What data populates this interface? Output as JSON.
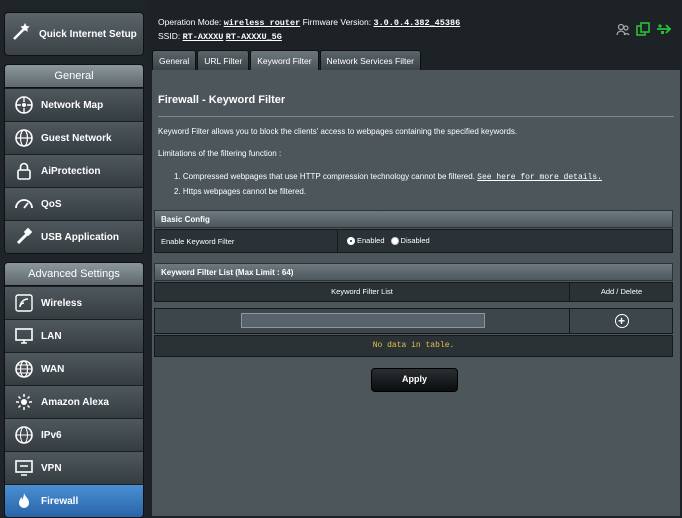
{
  "sidebar": {
    "quick_setup": "Quick Internet Setup",
    "general_header": "General",
    "general_items": [
      {
        "label": "Network Map",
        "icon": "network-map-icon"
      },
      {
        "label": "Guest Network",
        "icon": "guest-network-icon"
      },
      {
        "label": "AiProtection",
        "icon": "lock-icon"
      },
      {
        "label": "QoS",
        "icon": "gauge-icon"
      },
      {
        "label": "USB Application",
        "icon": "usb-icon"
      }
    ],
    "advanced_header": "Advanced Settings",
    "advanced_items": [
      {
        "label": "Wireless",
        "icon": "wireless-icon"
      },
      {
        "label": "LAN",
        "icon": "lan-icon"
      },
      {
        "label": "WAN",
        "icon": "globe-icon"
      },
      {
        "label": "Amazon Alexa",
        "icon": "alexa-icon"
      },
      {
        "label": "IPv6",
        "icon": "ipv6-icon"
      },
      {
        "label": "VPN",
        "icon": "vpn-icon"
      },
      {
        "label": "Firewall",
        "icon": "fire-icon"
      }
    ]
  },
  "topbar": {
    "op_mode_label": "Operation Mode:",
    "op_mode_value": "wireless router",
    "fw_label": "Firmware Version:",
    "fw_value": "3.0.0.4.382_45386",
    "ssid_label": "SSID:",
    "ssid_1": "RT-AXXXU",
    "ssid_2": "RT-AXXXU_5G"
  },
  "tabs": [
    "General",
    "URL Filter",
    "Keyword Filter",
    "Network Services Filter"
  ],
  "main": {
    "title": "Firewall - Keyword Filter",
    "description": "Keyword Filter allows you to block the clients' access to webpages containing the specified keywords.",
    "limitations_title": "Limitations of the filtering function :",
    "limitation_1": "1. Compressed webpages that use HTTP compression technology cannot be filtered.",
    "limitation_1_link": "See here for more details.",
    "limitation_2": "2. Https webpages cannot be filtered.",
    "basic_config_header": "Basic Config",
    "enable_label": "Enable Keyword Filter",
    "enabled_option": "Enabled",
    "disabled_option": "Disabled",
    "enable_value": "Enabled",
    "list_header": "Keyword Filter List (Max Limit : 64)",
    "col_keyword": "Keyword Filter List",
    "col_add_delete": "Add / Delete",
    "keyword_input_value": "",
    "no_data": "No data in table.",
    "apply_label": "Apply"
  },
  "colors": {
    "active_menu": "#3a7bc8",
    "no_data_text": "#e8c04a",
    "usb_status": "#28c038"
  }
}
